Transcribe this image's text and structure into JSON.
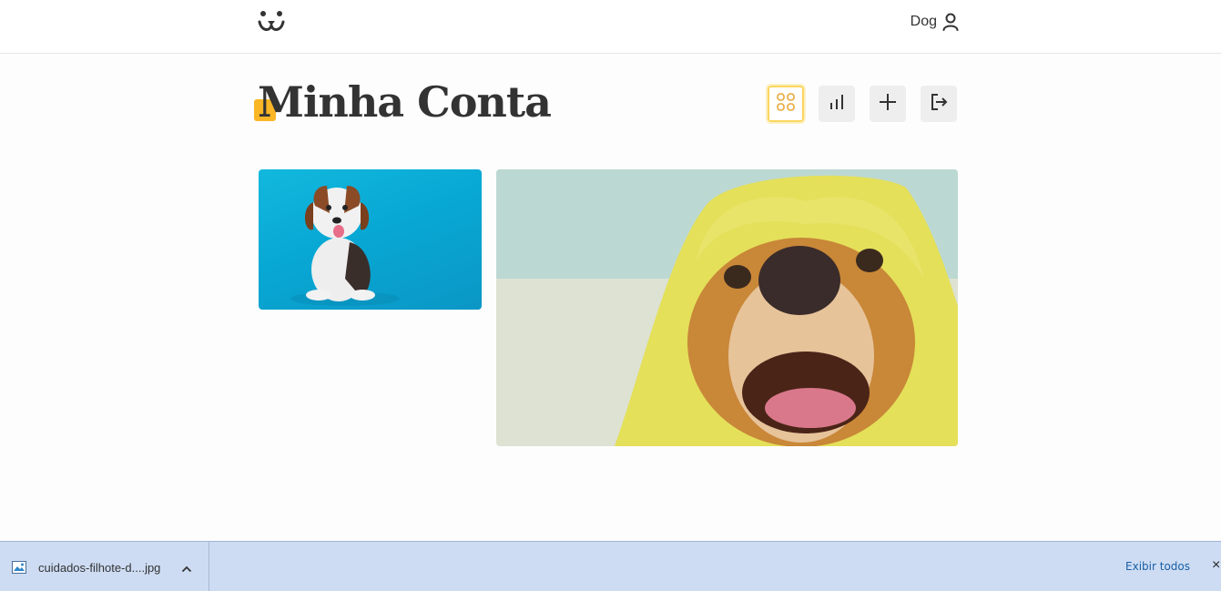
{
  "header": {
    "logo_icon": "dog-face-icon",
    "user_name": "Dog",
    "user_icon": "person-icon"
  },
  "page": {
    "title": "Minha Conta"
  },
  "toolbar": {
    "buttons": [
      {
        "name": "feed",
        "icon": "grid-icon",
        "active": true
      },
      {
        "name": "stats",
        "icon": "bar-chart-icon",
        "active": false
      },
      {
        "name": "add-photo",
        "icon": "plus-icon",
        "active": false
      },
      {
        "name": "logout",
        "icon": "logout-icon",
        "active": false
      }
    ],
    "accent_color": "#fbb626"
  },
  "photos": [
    {
      "subject": "beagle puppy on blue background"
    },
    {
      "subject": "dog under yellow towel"
    }
  ],
  "download_bar": {
    "file_name": "cuidados-filhote-d....jpg",
    "show_all_label": "Exibir todos",
    "close_label": "×"
  }
}
